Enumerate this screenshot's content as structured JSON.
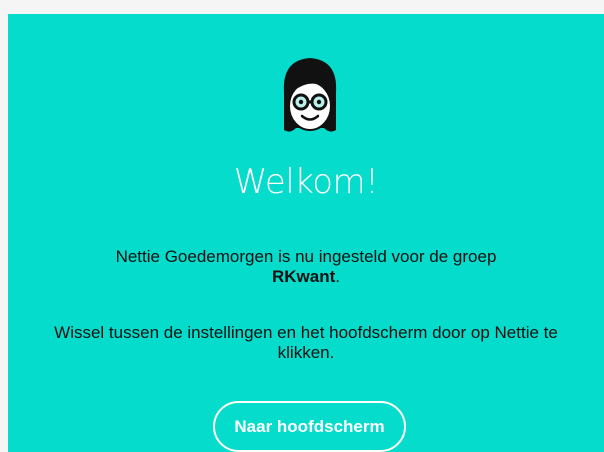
{
  "avatar": {
    "icon": "woman-with-glasses-avatar-icon"
  },
  "welcome": {
    "title": "Welkom!"
  },
  "message": {
    "line1": "Nettie Goedemorgen is nu ingesteld voor de groep",
    "group_name": "RKwant",
    "group_suffix": "."
  },
  "hint": {
    "line1": "Wissel tussen de instellingen en het hoofdscherm door op Nettie te",
    "line2": "klikken."
  },
  "actions": {
    "main_screen_label": "Naar hoofdscherm"
  },
  "colors": {
    "background": "#06dccb",
    "text": "#111111",
    "accent": "#ffffff"
  }
}
